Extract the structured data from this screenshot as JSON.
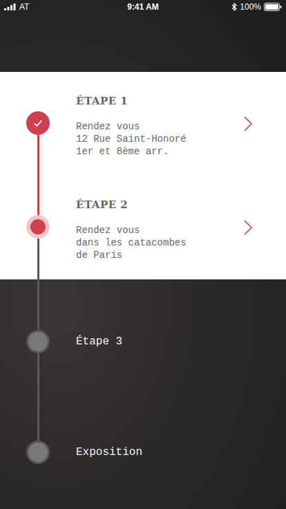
{
  "status_bar": {
    "carrier": "AT",
    "time": "9:41 AM",
    "battery": "100%"
  },
  "steps": [
    {
      "kind": "detail",
      "title": "ÉTAPE 1",
      "lines": [
        "Rendez vous",
        "12 Rue Saint-Honoré",
        "1er et 8ème arr."
      ],
      "completed": true,
      "selected": false
    },
    {
      "kind": "detail",
      "title": "ÉTAPE 2",
      "lines": [
        "Rendez vous",
        "dans les catacombes",
        "de Paris"
      ],
      "completed": false,
      "selected": true
    },
    {
      "kind": "simple",
      "title": "Étape 3",
      "lines": [],
      "completed": false,
      "selected": false
    },
    {
      "kind": "simple",
      "title": "Exposition",
      "lines": [],
      "completed": false,
      "selected": false
    }
  ]
}
